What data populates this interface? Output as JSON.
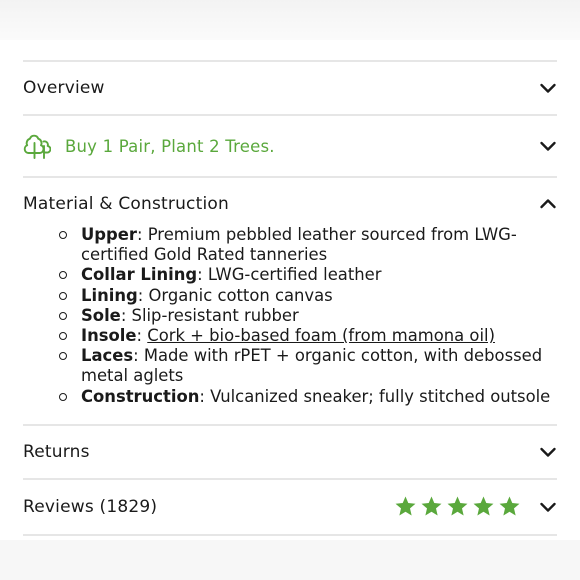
{
  "overview": {
    "title": "Overview"
  },
  "promo": {
    "text": "Buy 1 Pair, Plant 2 Trees."
  },
  "material": {
    "title": "Material & Construction",
    "items": [
      {
        "label": "Upper",
        "text": ": Premium pebbled leather sourced from LWG-certified Gold Rated tanneries"
      },
      {
        "label": "Collar Lining",
        "text": ": LWG-certified leather"
      },
      {
        "label": "Lining",
        "text": ": Organic cotton canvas"
      },
      {
        "label": "Sole",
        "text": ": Slip-resistant rubber"
      },
      {
        "label": "Insole",
        "sep": ": ",
        "link": "Cork + bio-based foam (from mamona oil)"
      },
      {
        "label": "Laces",
        "text": ": Made with rPET + organic cotton, with debossed metal aglets"
      },
      {
        "label": "Construction",
        "text": ": Vulcanized sneaker; fully stitched outsole"
      }
    ]
  },
  "returns": {
    "title": "Returns"
  },
  "reviews": {
    "title": "Reviews (1829)",
    "rating": 5,
    "rating_max": 5
  },
  "colors": {
    "accent_green": "#5aa83c",
    "text": "#1a1a1a",
    "divider": "#e6e6e6"
  },
  "icons": {
    "chevron_down": "chevron-down-icon",
    "chevron_up": "chevron-up-icon",
    "tree": "tree-icon",
    "star": "star-icon"
  }
}
